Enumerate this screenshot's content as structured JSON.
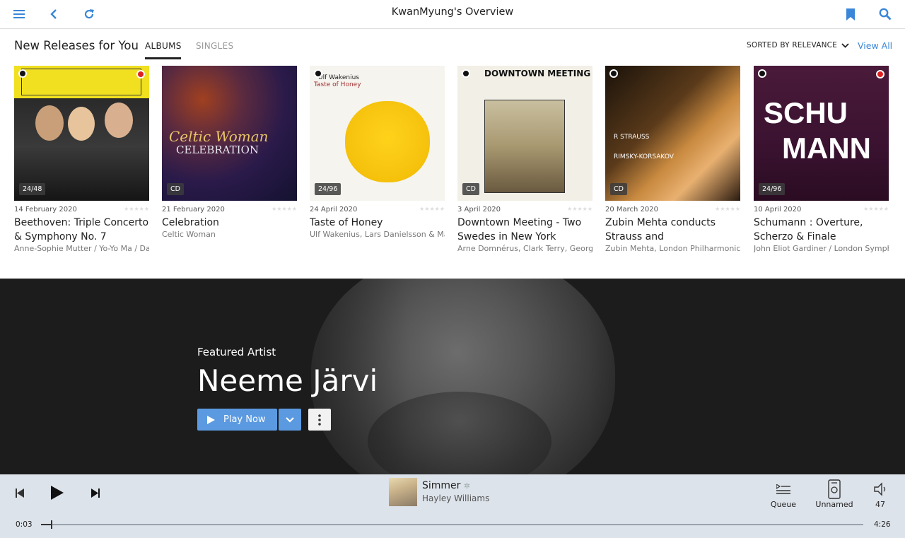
{
  "topbar": {
    "title": "KwanMyung's Overview",
    "icons": [
      "menu-icon",
      "back-icon",
      "refresh-icon",
      "bookmark-icon",
      "search-icon"
    ],
    "accent_color": "#3a86d8"
  },
  "new_releases": {
    "title": "New Releases for You",
    "tabs": [
      {
        "label": "ALBUMS",
        "active": true
      },
      {
        "label": "SINGLES",
        "active": false
      }
    ],
    "sort_label": "SORTED BY RELEVANCE",
    "view_all": "View All"
  },
  "albums": [
    {
      "date": "14 February 2020",
      "title": "Beethoven: Triple Concerto & Symphony No. 7",
      "artist": "Anne-Sophie Mutter / Yo-Yo Ma / Daniel Barenboim",
      "quality": "24/48",
      "stars": "★★★★★"
    },
    {
      "date": "21 February 2020",
      "title": "Celebration",
      "artist": "Celtic Woman",
      "quality": "CD",
      "stars": "★★★★★"
    },
    {
      "date": "24 April 2020",
      "title": "Taste of Honey",
      "artist": "Ulf Wakenius, Lars Danielsson & Magnus Öström",
      "quality": "24/96",
      "stars": "★★★★★"
    },
    {
      "date": "3 April 2020",
      "title": "Downtown Meeting - Two Swedes in New York",
      "artist": "Arne Domnérus, Clark Terry, George Mraz",
      "quality": "CD",
      "stars": "★★★★★"
    },
    {
      "date": "20 March 2020",
      "title": "Zubin Mehta conducts Strauss and",
      "artist": "Zubin Mehta, London Philharmonic Orchestra",
      "quality": "CD",
      "stars": "★★★★★"
    },
    {
      "date": "10 April 2020",
      "title": "Schumann : Overture, Scherzo & Finale",
      "artist": "John Eliot Gardiner / London Symphony Orchestra",
      "quality": "24/96",
      "stars": "★★★★★"
    }
  ],
  "featured": {
    "label": "Featured Artist",
    "name": "Neeme Järvi",
    "play_label": "Play Now"
  },
  "player": {
    "track": "Simmer",
    "artist": "Hayley Williams",
    "elapsed": "0:03",
    "duration": "4:26",
    "progress": 0.012,
    "queue_label": "Queue",
    "zone_label": "Unnamed",
    "volume": "47"
  }
}
